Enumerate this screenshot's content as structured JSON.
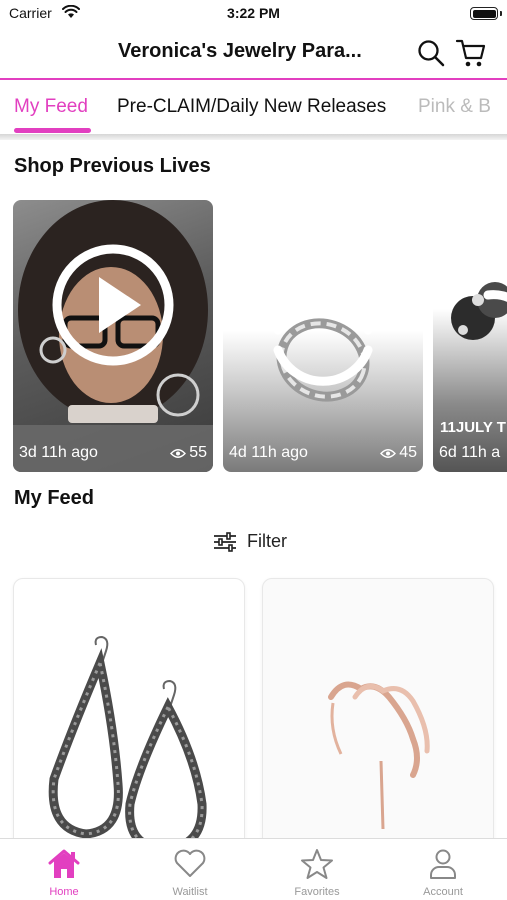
{
  "status_bar": {
    "carrier": "Carrier",
    "time": "3:22 PM"
  },
  "header": {
    "title": "Veronica's Jewelry Para..."
  },
  "tabs": [
    {
      "label": "My Feed"
    },
    {
      "label": "Pre-CLAIM/Daily New Releases"
    },
    {
      "label": "Pink & B"
    }
  ],
  "previous_lives": {
    "title": "Shop Previous Lives",
    "cards": [
      {
        "age": "3d 11h ago",
        "views": "55"
      },
      {
        "age": "4d 11h ago",
        "views": "45"
      },
      {
        "age": "6d 11h a",
        "overlay_title": "11JULY T"
      }
    ]
  },
  "feed": {
    "title": "My Feed",
    "filter_label": "Filter"
  },
  "tabbar": [
    {
      "label": "Home",
      "icon": "home-icon",
      "active": true
    },
    {
      "label": "Waitlist",
      "icon": "heart-icon"
    },
    {
      "label": "Favorites",
      "icon": "star-icon"
    },
    {
      "label": "Account",
      "icon": "person-icon"
    }
  ],
  "colors": {
    "accent": "#e23fc0",
    "inactive": "#999999"
  }
}
